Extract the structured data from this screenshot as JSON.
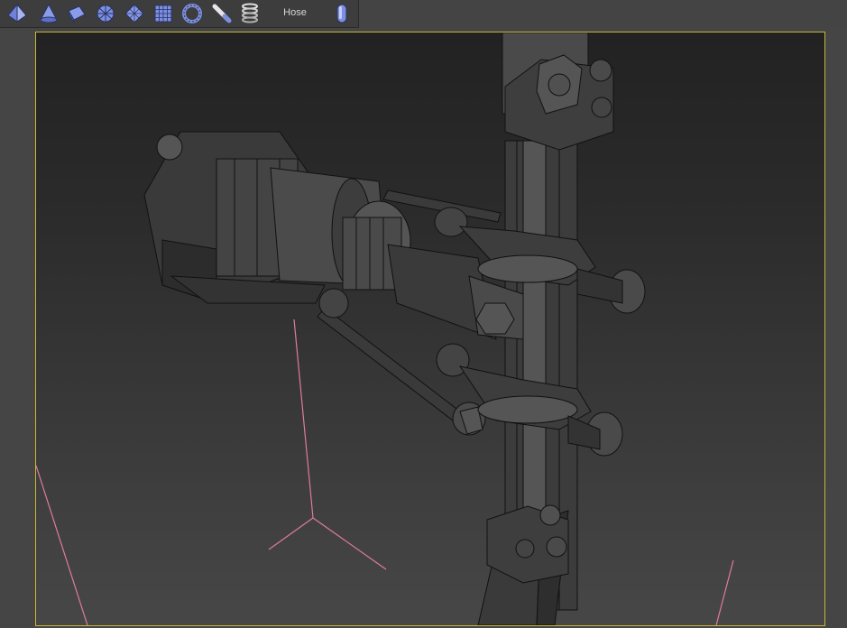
{
  "toolbar": {
    "buttons": [
      {
        "name": "pyramid-icon"
      },
      {
        "name": "cone-icon"
      },
      {
        "name": "plane-icon"
      },
      {
        "name": "geosphere-icon"
      },
      {
        "name": "grid-plane-icon"
      },
      {
        "name": "grid-box-icon"
      },
      {
        "name": "torus-icon"
      },
      {
        "name": "tube-tool-icon"
      },
      {
        "name": "spring-icon"
      }
    ],
    "hose_label": "Hose",
    "capsule_button": {
      "name": "capsule-icon"
    }
  },
  "colors": {
    "viewport_border": "#c9b634",
    "grid_axis": "#e07aa0",
    "icon_fill": "#8a9ce8",
    "panel": "#3d3d3d"
  }
}
